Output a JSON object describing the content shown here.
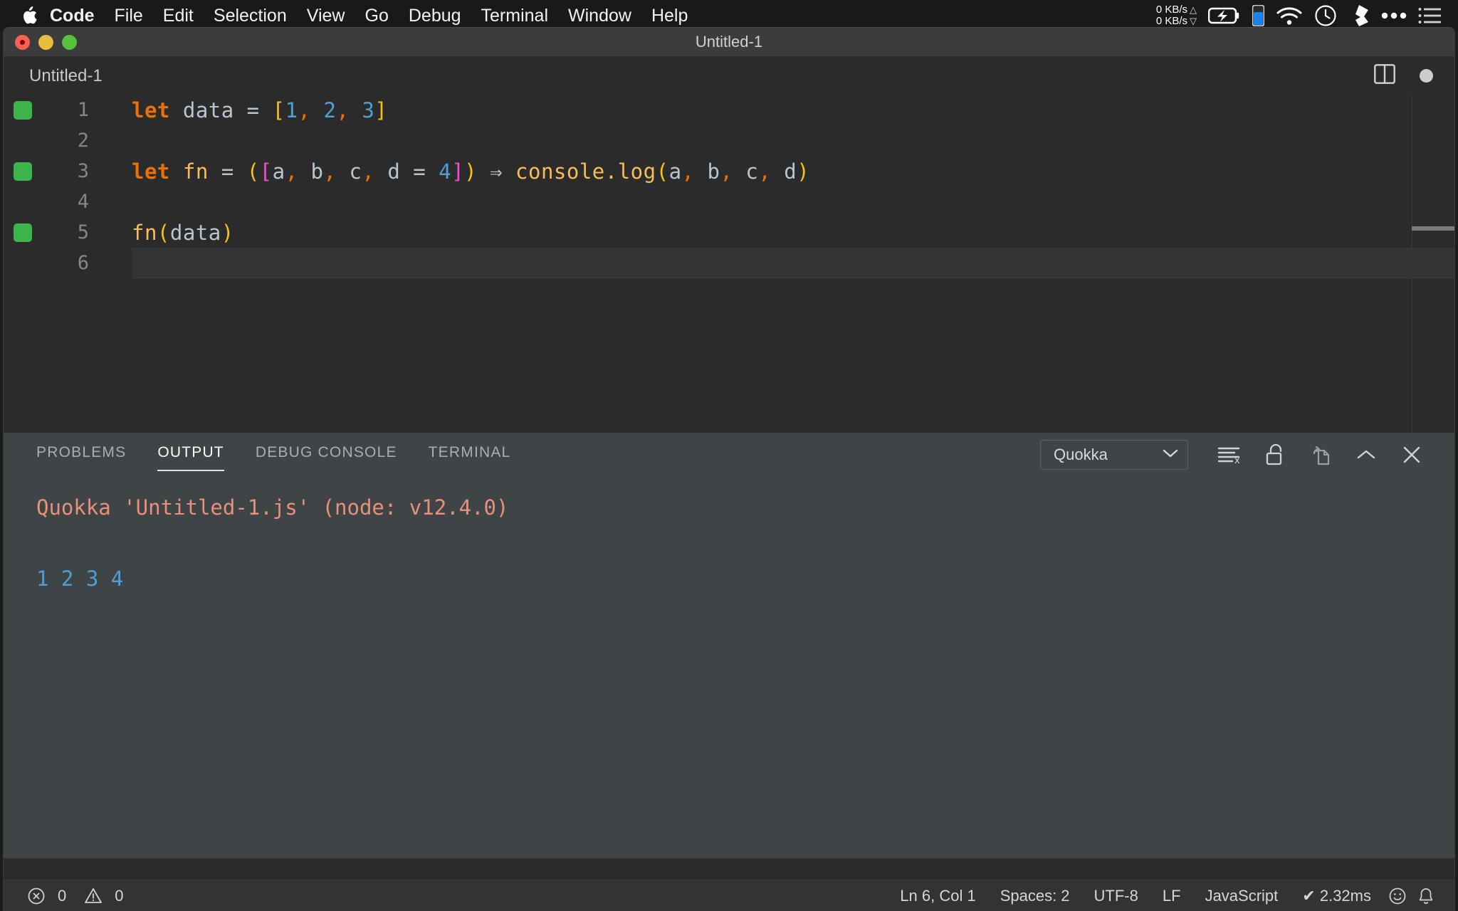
{
  "menubar": {
    "apple_icon": "apple-logo",
    "items": [
      {
        "label": "Code",
        "bold": true
      },
      {
        "label": "File",
        "bold": false
      },
      {
        "label": "Edit",
        "bold": false
      },
      {
        "label": "Selection",
        "bold": false
      },
      {
        "label": "View",
        "bold": false
      },
      {
        "label": "Go",
        "bold": false
      },
      {
        "label": "Debug",
        "bold": false
      },
      {
        "label": "Terminal",
        "bold": false
      },
      {
        "label": "Window",
        "bold": false
      },
      {
        "label": "Help",
        "bold": false
      }
    ],
    "network": {
      "up": "0 KB/s",
      "down": "0 KB/s",
      "up_arrow": "△",
      "down_arrow": "▽"
    },
    "status_icons": [
      "battery-charging-icon",
      "blue-indicator-icon",
      "wifi-icon",
      "clock-icon",
      "dropbox-icon",
      "ellipsis-icon",
      "list-icon"
    ]
  },
  "window": {
    "title": "Untitled-1",
    "traffic_lights": [
      "close-button",
      "minimize-button",
      "zoom-button"
    ]
  },
  "editor_tab": {
    "label": "Untitled-1",
    "actions": [
      "split-editor-icon",
      "unsaved-dot-indicator"
    ]
  },
  "editor": {
    "lines": [
      {
        "number": "1",
        "covered": true,
        "active": false,
        "tokens": [
          {
            "t": "let",
            "c": "tok-kw"
          },
          {
            "t": " ",
            "c": "tok-var"
          },
          {
            "t": "data",
            "c": "tok-var"
          },
          {
            "t": " ",
            "c": "tok-var"
          },
          {
            "t": "=",
            "c": "tok-op"
          },
          {
            "t": " ",
            "c": "tok-var"
          },
          {
            "t": "[",
            "c": "tok-br-y"
          },
          {
            "t": "1",
            "c": "tok-num"
          },
          {
            "t": ",",
            "c": "tok-punc"
          },
          {
            "t": " ",
            "c": "tok-var"
          },
          {
            "t": "2",
            "c": "tok-num"
          },
          {
            "t": ",",
            "c": "tok-punc"
          },
          {
            "t": " ",
            "c": "tok-var"
          },
          {
            "t": "3",
            "c": "tok-num"
          },
          {
            "t": "]",
            "c": "tok-br-y"
          }
        ]
      },
      {
        "number": "2",
        "covered": false,
        "active": false,
        "tokens": []
      },
      {
        "number": "3",
        "covered": true,
        "active": false,
        "tokens": [
          {
            "t": "let",
            "c": "tok-kw"
          },
          {
            "t": " ",
            "c": "tok-var"
          },
          {
            "t": "fn",
            "c": "tok-fn"
          },
          {
            "t": " ",
            "c": "tok-var"
          },
          {
            "t": "=",
            "c": "tok-op"
          },
          {
            "t": " ",
            "c": "tok-var"
          },
          {
            "t": "(",
            "c": "tok-br-y"
          },
          {
            "t": "[",
            "c": "tok-br-m"
          },
          {
            "t": "a",
            "c": "tok-var"
          },
          {
            "t": ",",
            "c": "tok-punc"
          },
          {
            "t": " ",
            "c": "tok-var"
          },
          {
            "t": "b",
            "c": "tok-var"
          },
          {
            "t": ",",
            "c": "tok-punc"
          },
          {
            "t": " ",
            "c": "tok-var"
          },
          {
            "t": "c",
            "c": "tok-var"
          },
          {
            "t": ",",
            "c": "tok-punc"
          },
          {
            "t": " ",
            "c": "tok-var"
          },
          {
            "t": "d",
            "c": "tok-var"
          },
          {
            "t": " ",
            "c": "tok-var"
          },
          {
            "t": "=",
            "c": "tok-op"
          },
          {
            "t": " ",
            "c": "tok-var"
          },
          {
            "t": "4",
            "c": "tok-num"
          },
          {
            "t": "]",
            "c": "tok-br-m"
          },
          {
            "t": ")",
            "c": "tok-br-y"
          },
          {
            "t": " ",
            "c": "tok-var"
          },
          {
            "t": "⇒",
            "c": "tok-arrow"
          },
          {
            "t": " ",
            "c": "tok-var"
          },
          {
            "t": "console.log",
            "c": "tok-call"
          },
          {
            "t": "(",
            "c": "tok-br-y"
          },
          {
            "t": "a",
            "c": "tok-var"
          },
          {
            "t": ",",
            "c": "tok-punc"
          },
          {
            "t": " ",
            "c": "tok-var"
          },
          {
            "t": "b",
            "c": "tok-var"
          },
          {
            "t": ",",
            "c": "tok-punc"
          },
          {
            "t": " ",
            "c": "tok-var"
          },
          {
            "t": "c",
            "c": "tok-var"
          },
          {
            "t": ",",
            "c": "tok-punc"
          },
          {
            "t": " ",
            "c": "tok-var"
          },
          {
            "t": "d",
            "c": "tok-var"
          },
          {
            "t": ")",
            "c": "tok-br-y"
          }
        ]
      },
      {
        "number": "4",
        "covered": false,
        "active": false,
        "tokens": []
      },
      {
        "number": "5",
        "covered": true,
        "active": false,
        "tokens": [
          {
            "t": "fn",
            "c": "tok-fn"
          },
          {
            "t": "(",
            "c": "tok-br-y"
          },
          {
            "t": "data",
            "c": "tok-var"
          },
          {
            "t": ")",
            "c": "tok-br-y"
          }
        ]
      },
      {
        "number": "6",
        "covered": false,
        "active": true,
        "tokens": []
      }
    ],
    "raw_text": "let data = [1, 2, 3]\n\nlet fn = ([a, b, c, d = 4]) ⇒ console.log(a, b, c, d)\n\nfn(data)\n"
  },
  "panel": {
    "tabs": [
      {
        "label": "PROBLEMS",
        "active": false
      },
      {
        "label": "OUTPUT",
        "active": true
      },
      {
        "label": "DEBUG CONSOLE",
        "active": false
      },
      {
        "label": "TERMINAL",
        "active": false
      }
    ],
    "channel_select": {
      "value": "Quokka",
      "chevron": "chevron-down-icon"
    },
    "actions": [
      "clear-output-icon",
      "unlock-icon",
      "open-in-editor-icon",
      "maximize-panel-icon",
      "close-panel-icon"
    ],
    "output": [
      {
        "text": "Quokka 'Untitled-1.js' (node: v12.4.0)",
        "style": "out-head"
      },
      {
        "text": "",
        "style": "out-blank"
      },
      {
        "text": "1 2 3 4",
        "style": "out-val"
      }
    ]
  },
  "statusbar": {
    "errors": "0",
    "warnings": "0",
    "error_icon": "error-circle-icon",
    "warning_icon": "warning-triangle-icon",
    "items": [
      "Ln 6, Col 1",
      "Spaces: 2",
      "UTF-8",
      "LF",
      "JavaScript"
    ],
    "quokka_check": "✔",
    "quokka_time": "2.32ms",
    "right_icons": [
      "feedback-smiley-icon",
      "notifications-bell-icon"
    ]
  },
  "colors": {
    "keyword": "#e8710a",
    "number": "#4f9fd4",
    "function": "#f9bd57",
    "bracket_yellow": "#f5c211",
    "bracket_magenta": "#ef4fcf",
    "variable": "#b8c6d4",
    "coverage_green": "#3cb44a",
    "output_header": "#e8907a",
    "panel_bg": "#3f4447",
    "editor_bg": "#2b2b2b"
  }
}
